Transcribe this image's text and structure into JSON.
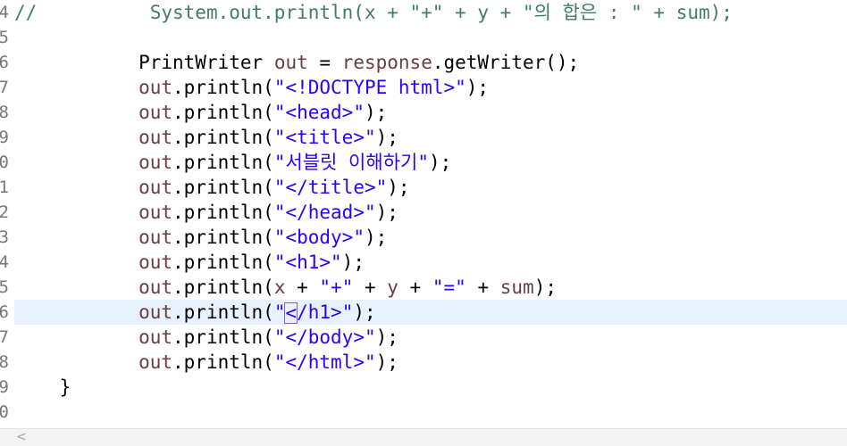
{
  "editor": {
    "line_numbers": [
      "4",
      "5",
      "6",
      "7",
      "8",
      "9",
      "0",
      "1",
      "2",
      "3",
      "4",
      "5",
      "6",
      "7",
      "8",
      "9",
      "0"
    ],
    "lines": [
      {
        "tokens": [
          {
            "t": "//",
            "c": "comment"
          },
          {
            "t": "          System.out.println(x + \"+\" + y + \"의 합은 : \" + sum);",
            "c": "comment"
          }
        ]
      },
      {
        "tokens": []
      },
      {
        "tokens": [
          {
            "t": "           ",
            "c": "ident"
          },
          {
            "t": "PrintWriter",
            "c": "ident"
          },
          {
            "t": " ",
            "c": "ident"
          },
          {
            "t": "out",
            "c": "field"
          },
          {
            "t": " = ",
            "c": "op"
          },
          {
            "t": "response",
            "c": "field"
          },
          {
            "t": ".getWriter();",
            "c": "ident"
          }
        ]
      },
      {
        "tokens": [
          {
            "t": "           ",
            "c": "ident"
          },
          {
            "t": "out",
            "c": "field"
          },
          {
            "t": ".println(",
            "c": "ident"
          },
          {
            "t": "\"<!DOCTYPE html>\"",
            "c": "str"
          },
          {
            "t": ");",
            "c": "ident"
          }
        ]
      },
      {
        "tokens": [
          {
            "t": "           ",
            "c": "ident"
          },
          {
            "t": "out",
            "c": "field"
          },
          {
            "t": ".println(",
            "c": "ident"
          },
          {
            "t": "\"<head>\"",
            "c": "str"
          },
          {
            "t": ");",
            "c": "ident"
          }
        ]
      },
      {
        "tokens": [
          {
            "t": "           ",
            "c": "ident"
          },
          {
            "t": "out",
            "c": "field"
          },
          {
            "t": ".println(",
            "c": "ident"
          },
          {
            "t": "\"<title>\"",
            "c": "str"
          },
          {
            "t": ");",
            "c": "ident"
          }
        ]
      },
      {
        "tokens": [
          {
            "t": "           ",
            "c": "ident"
          },
          {
            "t": "out",
            "c": "field"
          },
          {
            "t": ".println(",
            "c": "ident"
          },
          {
            "t": "\"서블릿 이해하기\"",
            "c": "str"
          },
          {
            "t": ");",
            "c": "ident"
          }
        ]
      },
      {
        "tokens": [
          {
            "t": "           ",
            "c": "ident"
          },
          {
            "t": "out",
            "c": "field"
          },
          {
            "t": ".println(",
            "c": "ident"
          },
          {
            "t": "\"</title>\"",
            "c": "str"
          },
          {
            "t": ");",
            "c": "ident"
          }
        ]
      },
      {
        "tokens": [
          {
            "t": "           ",
            "c": "ident"
          },
          {
            "t": "out",
            "c": "field"
          },
          {
            "t": ".println(",
            "c": "ident"
          },
          {
            "t": "\"</head>\"",
            "c": "str"
          },
          {
            "t": ");",
            "c": "ident"
          }
        ]
      },
      {
        "tokens": [
          {
            "t": "           ",
            "c": "ident"
          },
          {
            "t": "out",
            "c": "field"
          },
          {
            "t": ".println(",
            "c": "ident"
          },
          {
            "t": "\"<body>\"",
            "c": "str"
          },
          {
            "t": ");",
            "c": "ident"
          }
        ]
      },
      {
        "tokens": [
          {
            "t": "           ",
            "c": "ident"
          },
          {
            "t": "out",
            "c": "field"
          },
          {
            "t": ".println(",
            "c": "ident"
          },
          {
            "t": "\"<h1>\"",
            "c": "str"
          },
          {
            "t": ");",
            "c": "ident"
          }
        ]
      },
      {
        "tokens": [
          {
            "t": "           ",
            "c": "ident"
          },
          {
            "t": "out",
            "c": "field"
          },
          {
            "t": ".println(",
            "c": "ident"
          },
          {
            "t": "x",
            "c": "field"
          },
          {
            "t": " + ",
            "c": "op"
          },
          {
            "t": "\"+\"",
            "c": "str"
          },
          {
            "t": " + ",
            "c": "op"
          },
          {
            "t": "y",
            "c": "field"
          },
          {
            "t": " + ",
            "c": "op"
          },
          {
            "t": "\"=\"",
            "c": "str"
          },
          {
            "t": " + ",
            "c": "op"
          },
          {
            "t": "sum",
            "c": "field"
          },
          {
            "t": ");",
            "c": "ident"
          }
        ]
      },
      {
        "current": true,
        "tokens": [
          {
            "t": "           ",
            "c": "ident"
          },
          {
            "t": "out",
            "c": "field"
          },
          {
            "t": ".println(",
            "c": "ident"
          },
          {
            "t": "\"",
            "c": "str"
          },
          {
            "t": "<",
            "c": "str",
            "caret": true
          },
          {
            "t": "/h1>\"",
            "c": "str"
          },
          {
            "t": ");",
            "c": "ident"
          }
        ]
      },
      {
        "tokens": [
          {
            "t": "           ",
            "c": "ident"
          },
          {
            "t": "out",
            "c": "field"
          },
          {
            "t": ".println(",
            "c": "ident"
          },
          {
            "t": "\"</body>\"",
            "c": "str"
          },
          {
            "t": ");",
            "c": "ident"
          }
        ]
      },
      {
        "tokens": [
          {
            "t": "           ",
            "c": "ident"
          },
          {
            "t": "out",
            "c": "field"
          },
          {
            "t": ".println(",
            "c": "ident"
          },
          {
            "t": "\"</html>\"",
            "c": "str"
          },
          {
            "t": ");",
            "c": "ident"
          }
        ]
      },
      {
        "tokens": [
          {
            "t": "    }",
            "c": "ident"
          }
        ]
      },
      {
        "tokens": []
      }
    ]
  },
  "scrollbar": {
    "left_arrow": "<"
  },
  "colors": {
    "current_line": "#e8f2fe",
    "string": "#2a00ff",
    "field": "#6a3e3e",
    "comment": "#3f7f5f"
  }
}
